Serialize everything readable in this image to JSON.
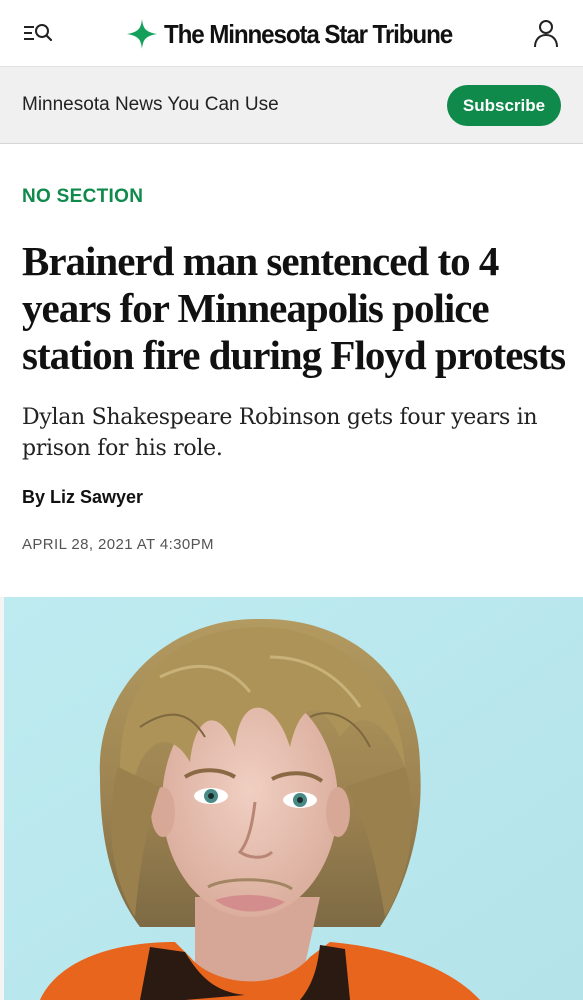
{
  "header": {
    "brand_name": "The Minnesota Star Tribune",
    "menu_search_icon": "menu-search-icon",
    "account_icon": "user-account-icon",
    "brand_icon": "north-star-icon",
    "brand_color": "#0f8a4b"
  },
  "promo": {
    "text": "Minnesota News You Can Use",
    "subscribe_label": "Subscribe"
  },
  "article": {
    "section": "NO SECTION",
    "headline": "Brainerd man sentenced to 4 years for Minneapolis police station fire during Floyd protests",
    "dek": "Dylan Shakespeare Robinson gets four years in prison for his role.",
    "byline": "By Liz Sawyer",
    "date": "APRIL 28, 2021 AT 4:30PM"
  },
  "photo": {
    "subject": "booking-photo",
    "background_color": "#b9e8ef"
  }
}
